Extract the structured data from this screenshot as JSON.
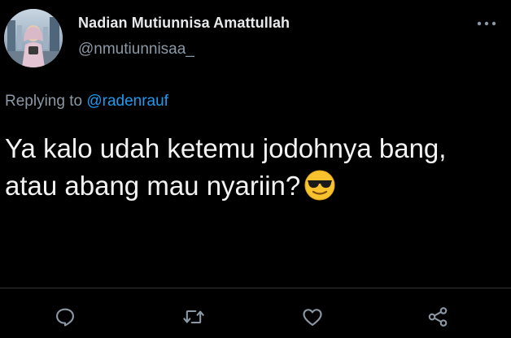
{
  "colors": {
    "background": "#000000",
    "primary_text": "#e7e9ea",
    "secondary_text": "#8b98a5",
    "link": "#1d9bf0",
    "divider": "#2f3336"
  },
  "author": {
    "display_name": "Nadian Mutiunnisa Amattullah",
    "handle": "@nmutiunnisaa_"
  },
  "reply": {
    "prefix": "Replying to",
    "mention": "@radenrauf"
  },
  "tweet": {
    "line1": "Ya kalo udah ketemu jodohnya bang,",
    "line2": "atau abang mau nyariin?",
    "emoji": "smiling-face-with-sunglasses"
  },
  "actions": [
    "reply-icon",
    "retweet-icon",
    "like-icon",
    "share-icon"
  ],
  "menu_icon": "more-options-icon"
}
